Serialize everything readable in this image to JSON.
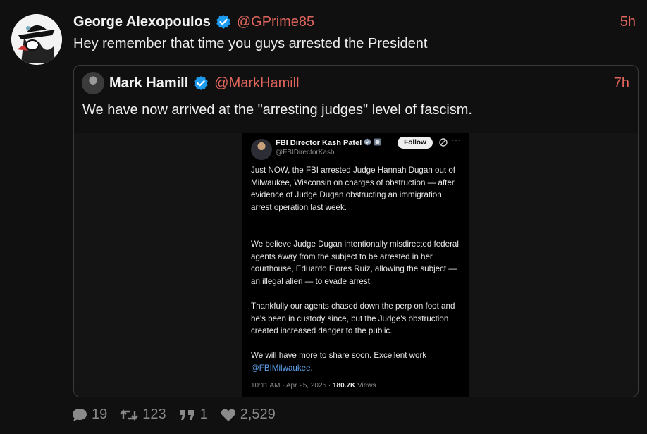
{
  "post": {
    "author": "George Alexopoulos",
    "handle": "@GPrime85",
    "time": "5h",
    "text": "Hey remember that time you guys arrested the President"
  },
  "quote": {
    "author": "Mark Hamill",
    "handle": "@MarkHamill",
    "time": "7h",
    "text": "We have now arrived at the \"arresting judges\" level of fascism.",
    "media": {
      "author": "FBI Director Kash Patel",
      "handle": "@FBIDirectorKash",
      "follow_label": "Follow",
      "more": "···",
      "paragraphs": [
        "Just NOW, the FBI arrested Judge Hannah Dugan out of Milwaukee, Wisconsin on charges of obstruction — after evidence of Judge Dugan obstructing an immigration arrest operation last week.",
        "We believe Judge Dugan intentionally misdirected federal agents away from the subject to be arrested in her courthouse, Eduardo Flores Ruiz, allowing the subject — an illegal alien — to evade arrest.",
        "Thankfully our agents chased down the perp on foot and he's been in custody since, but the Judge's obstruction created increased danger to the public.",
        "We will have more to share soon. Excellent work"
      ],
      "mention": "@FBIMilwaukee",
      "mention_suffix": ".",
      "timestamp": "10:11 AM · Apr 25, 2025 · ",
      "views_count": "180.7K",
      "views_label": " Views"
    }
  },
  "stats": {
    "replies": "19",
    "reposts": "123",
    "quotes": "1",
    "likes": "2,529"
  },
  "colors": {
    "accent": "#e0655d",
    "verified": "#1d9bf0",
    "link": "#5ea1ec"
  }
}
